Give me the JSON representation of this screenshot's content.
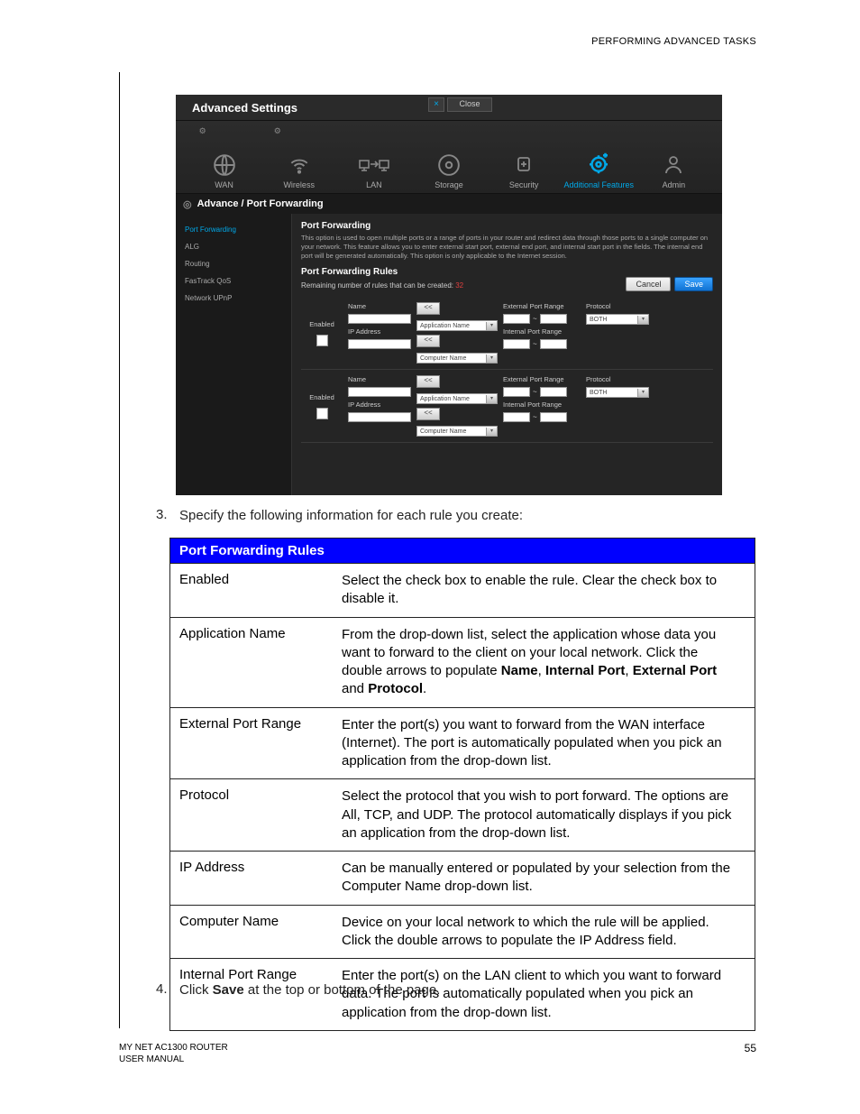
{
  "header": "PERFORMING ADVANCED TASKS",
  "screenshot": {
    "title": "Advanced Settings",
    "close_label": "Close",
    "nav": [
      "WAN",
      "Wireless",
      "LAN",
      "Storage",
      "Security",
      "Additional Features",
      "Admin"
    ],
    "breadcrumb": "Advance / Port Forwarding",
    "sidebar": [
      "Port Forwarding",
      "ALG",
      "Routing",
      "FasTrack QoS",
      "Network UPnP"
    ],
    "pf_title": "Port Forwarding",
    "pf_expl": "This option is used to open multiple ports or a range of ports in your router and redirect data through those ports to a single computer on your network. This feature allows you to enter external start port, external end port, and internal start port in the fields. The internal end port will be generated automatically. This option is only applicable to the Internet session.",
    "pf_rules_title": "Port Forwarding Rules",
    "remaining_label": "Remaining number of rules that can be created:",
    "remaining_num": "32",
    "cancel": "Cancel",
    "save": "Save",
    "enabled_label": "Enabled",
    "name_label": "Name",
    "ip_label": "IP Address",
    "app_name": "Application Name",
    "comp_name": "Computer Name",
    "ext_port": "External Port Range",
    "int_port": "Internal Port Range",
    "protocol_label": "Protocol",
    "protocol_value": "BOTH",
    "arrows": "<<"
  },
  "step3_num": "3.",
  "step3_text": "Specify the following information for each rule you create:",
  "table": {
    "header": "Port Forwarding Rules",
    "rows": [
      {
        "k": "Enabled",
        "v": "Select the check box to enable the rule. Clear the check box to disable it."
      },
      {
        "k": "Application Name",
        "v": "From the drop-down list, select the application whose data you want to forward to the client on your local network. Click the double arrows to populate <b>Name</b>, <b>Internal Port</b>, <b>External Port</b> and <b>Protocol</b>."
      },
      {
        "k": "External Port Range",
        "v": "Enter the port(s) you want to forward from the WAN interface (Internet). The port is automatically populated when you pick an application from the drop-down list."
      },
      {
        "k": "Protocol",
        "v": "Select the protocol that you wish to port forward. The options are All, TCP, and UDP. The protocol automatically displays if you pick an application from the drop-down list."
      },
      {
        "k": "IP Address",
        "v": "Can be manually entered or populated by your selection from the Computer Name drop-down list."
      },
      {
        "k": "Computer Name",
        "v": "Device on your local network to which the rule will be applied. Click the double arrows to populate the IP Address field."
      },
      {
        "k": "Internal Port Range",
        "v": "Enter the port(s) on the LAN client to which you want to forward data. The port is automatically populated when you pick an application from the drop-down list."
      }
    ]
  },
  "step4_num": "4.",
  "step4_pre": "Click ",
  "step4_bold": "Save",
  "step4_post": " at the top or bottom of the page.",
  "footer_left_1": "MY NET AC1300 ROUTER",
  "footer_left_2": "USER MANUAL",
  "footer_right": "55"
}
